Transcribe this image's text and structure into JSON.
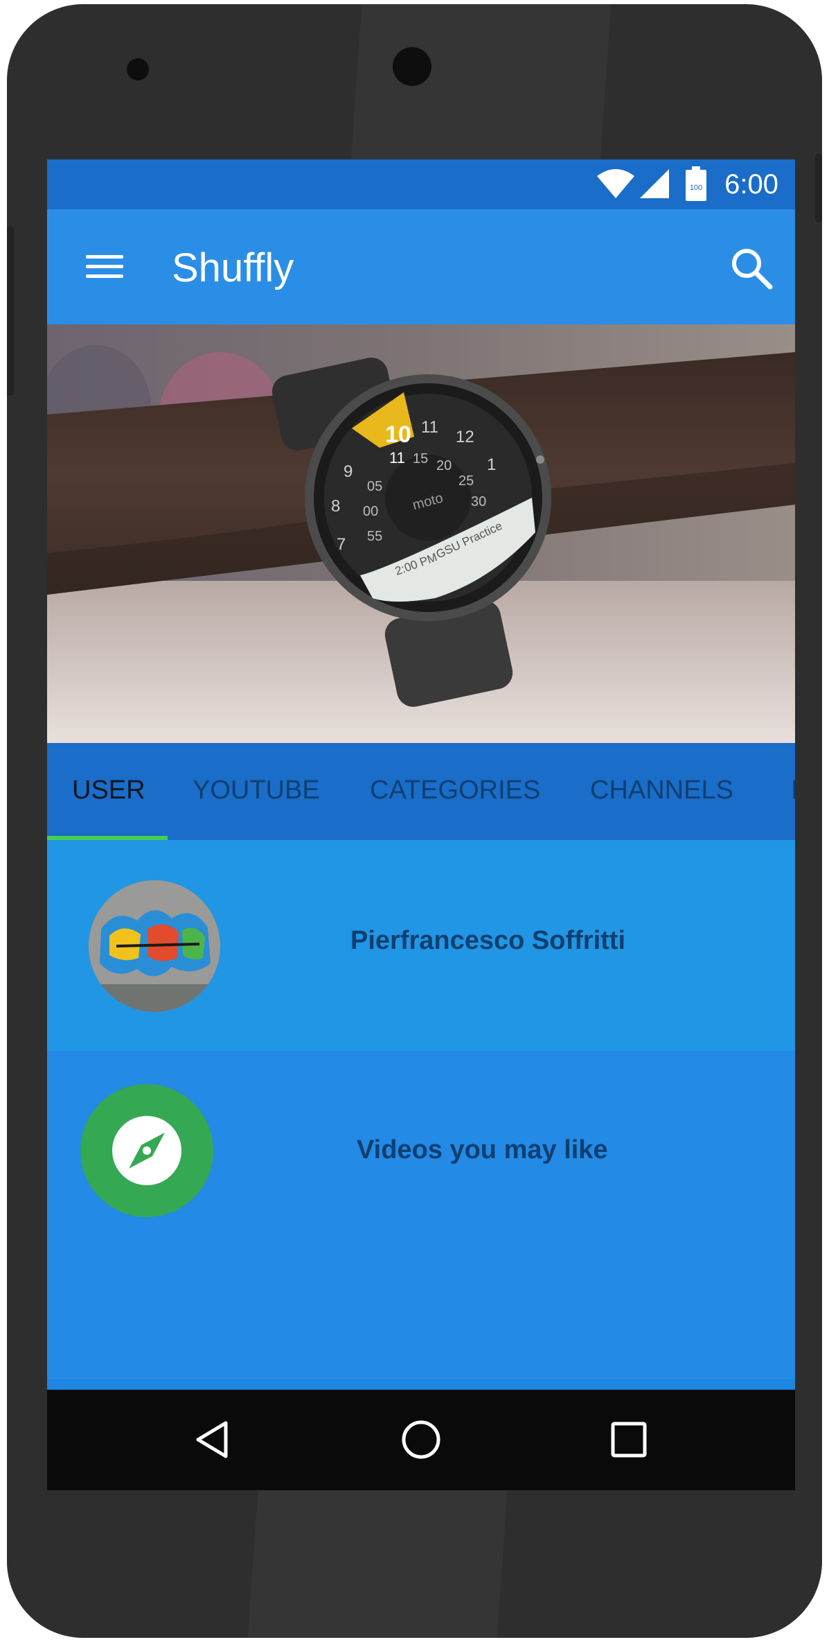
{
  "status_bar": {
    "time": "6:00",
    "battery_level": "100",
    "icons": [
      "wifi-icon",
      "signal-icon",
      "battery-icon"
    ]
  },
  "app_bar": {
    "title": "Shuffly",
    "icons": [
      "menu-icon",
      "search-icon"
    ]
  },
  "hero": {
    "watch_brand": "moto",
    "hour_highlight": "10",
    "event_time": "2:00 PM",
    "event_title": "GSU Practice",
    "dial_numbers": [
      "9",
      "8",
      "7",
      "11",
      "12",
      "1",
      "11",
      "15",
      "20",
      "25",
      "30",
      "05",
      "00",
      "55"
    ]
  },
  "tabs": [
    {
      "label": "USER",
      "active": true
    },
    {
      "label": "YOUTUBE",
      "active": false
    },
    {
      "label": "CATEGORIES",
      "active": false
    },
    {
      "label": "CHANNELS",
      "active": false
    },
    {
      "label": "I",
      "active": false
    }
  ],
  "list": [
    {
      "title": "Pierfrancesco Soffritti",
      "icon": "avatar"
    },
    {
      "title": "Videos you may like",
      "icon": "compass-icon"
    }
  ],
  "nav_bar": {
    "icons": [
      "back-icon",
      "home-icon",
      "recents-icon"
    ]
  },
  "colors": {
    "status_bar": "#1a6dc8",
    "app_bar": "#2b8ee6",
    "tab_indicator": "#44d052",
    "explore_green": "#35a853",
    "nav_bar": "#0a0a0a"
  }
}
